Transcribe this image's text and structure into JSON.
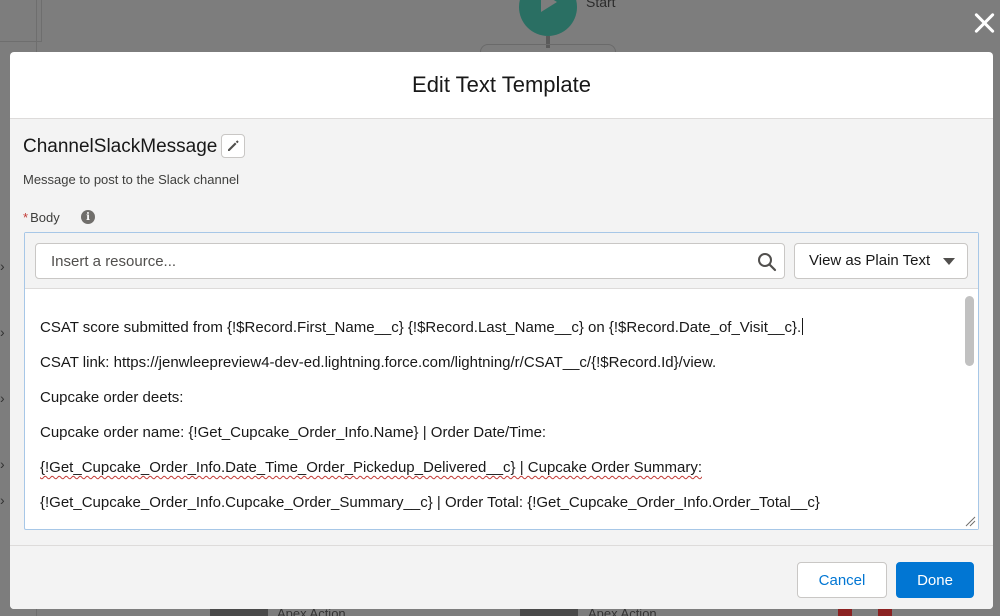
{
  "background": {
    "start_label": "Start",
    "apex_action_labels": [
      "Apex Action",
      "Apex Action"
    ]
  },
  "modal": {
    "title": "Edit Text Template",
    "template_name": "ChannelSlackMessage",
    "description": "Message to post to the Slack channel",
    "body_label": "Body",
    "required_marker": "*"
  },
  "editor": {
    "resource_placeholder": "Insert a resource...",
    "view_mode": "View as Plain Text",
    "lines": [
      "CSAT score submitted from {!$Record.First_Name__c}  {!$Record.Last_Name__c} on {!$Record.Date_of_Visit__c}.",
      "CSAT link: https://jenwleepreview4-dev-ed.lightning.force.com/lightning/r/CSAT__c/{!$Record.Id}/view.",
      "Cupcake order deets:",
      "Cupcake order name: {!Get_Cupcake_Order_Info.Name} | Order Date/Time:",
      "{!Get_Cupcake_Order_Info.Date_Time_Order_Pickedup_Delivered__c} | Cupcake Order Summary:",
      "{!Get_Cupcake_Order_Info.Cupcake_Order_Summary__c} | Order Total:  {!Get_Cupcake_Order_Info.Order_Total__c}"
    ]
  },
  "footer": {
    "cancel_label": "Cancel",
    "done_label": "Done"
  },
  "colors": {
    "brand": "#0176d3",
    "required": "#c23934"
  },
  "icons": [
    "close-icon",
    "pencil-icon",
    "info-icon",
    "search-icon",
    "chevron-down-icon",
    "resize-handle-icon",
    "play-icon"
  ]
}
